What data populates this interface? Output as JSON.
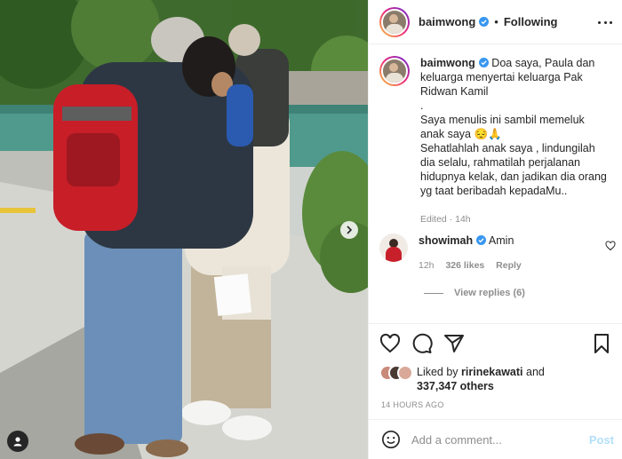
{
  "post": {
    "image_alt": "",
    "author": "baimwong",
    "follow_state": "Following",
    "caption_text": "Doa saya, Paula dan keluarga menyertai keluarga Pak Ridwan Kamil\n.\nSaya menulis ini sambil memeluk anak saya 😔🙏\nSehatlahlah anak saya , lindungilah dia selalu, rahmatilah perjalanan hidupnya kelak, dan jadikan dia orang yg taat beribadah kepadaMu..",
    "caption_meta": "Edited · 14h",
    "verified_color": "#3897f0"
  },
  "comment": {
    "author": "showimah",
    "text": "Amin",
    "age": "12h",
    "likes": "326 likes",
    "reply_label": "Reply",
    "view_replies": "View replies (6)"
  },
  "engagement": {
    "liked_by_prefix": "Liked by",
    "liked_by_user": "ririnekawati",
    "liked_by_and": "and",
    "others": "337,347 others",
    "time_ago": "14 HOURS AGO"
  },
  "composer": {
    "placeholder": "Add a comment...",
    "post_label": "Post"
  },
  "icons": {
    "like": "heart-icon",
    "comment": "comment-icon",
    "share": "send-icon",
    "save": "bookmark-icon",
    "emoji": "emoji-icon",
    "more": "more-options-icon",
    "next": "chevron-right-icon",
    "tags": "user-tag-icon"
  }
}
